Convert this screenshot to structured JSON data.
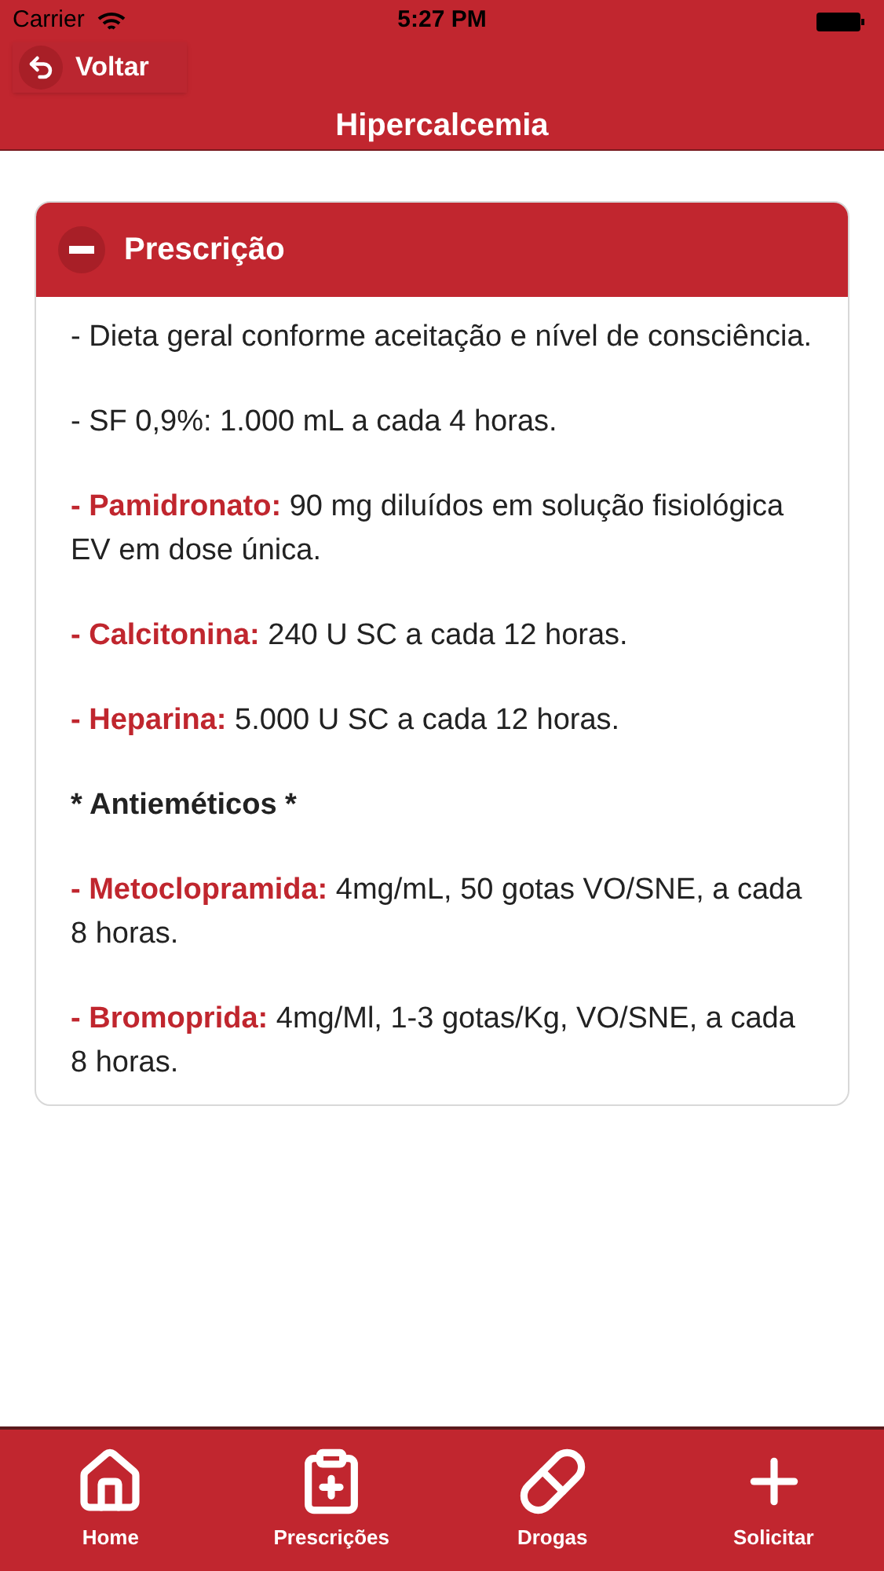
{
  "status_bar": {
    "carrier": "Carrier",
    "time": "5:27 PM"
  },
  "nav_bar": {
    "back_label": "Voltar",
    "title": "Hipercalcemia"
  },
  "section": {
    "title": "Prescrição",
    "expanded": true,
    "items": [
      {
        "kind": "plain",
        "text": "- Dieta geral conforme aceitação e nível de consciência."
      },
      {
        "kind": "plain",
        "text": "- SF 0,9%: 1.000 mL a cada 4 horas."
      },
      {
        "kind": "drug",
        "drug": "- Pamidronato:",
        "text": "90 mg diluídos em solução fisiológica EV em dose única."
      },
      {
        "kind": "drug",
        "drug": "- Calcitonina:",
        "text": "240 U SC a cada 12 horas."
      },
      {
        "kind": "drug",
        "drug": "- Heparina:",
        "text": "5.000 U SC a cada 12 horas."
      },
      {
        "kind": "heading",
        "text": "* Antieméticos *"
      },
      {
        "kind": "drug",
        "drug": "- Metoclopramida:",
        "text": "4mg/mL, 50 gotas VO/SNE, a cada 8 horas."
      },
      {
        "kind": "drug",
        "drug": "- Bromoprida:",
        "text": "4mg/Ml, 1-3 gotas/Kg, VO/SNE, a cada 8 horas."
      }
    ]
  },
  "tab_bar": [
    {
      "kind": "home",
      "label": "Home"
    },
    {
      "kind": "prescriptions",
      "label": "Prescrições"
    },
    {
      "kind": "drugs",
      "label": "Drogas"
    },
    {
      "kind": "request",
      "label": "Solicitar"
    }
  ]
}
